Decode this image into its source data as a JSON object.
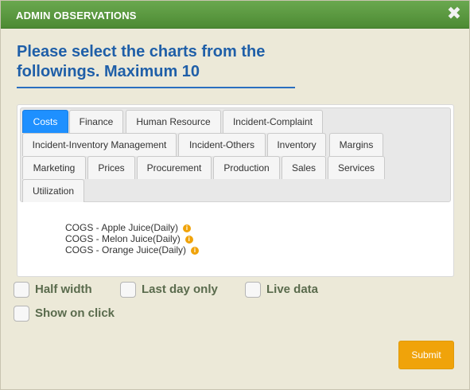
{
  "dialog": {
    "title": "ADMIN OBSERVATIONS",
    "close_icon": "close-icon",
    "heading": "Please select the charts from the followings. Maximum 10"
  },
  "tabs": [
    {
      "label": "Costs",
      "active": true
    },
    {
      "label": "Finance"
    },
    {
      "label": "Human Resource"
    },
    {
      "label": "Incident-Complaint"
    },
    {
      "label": "Incident-Inventory Management"
    },
    {
      "label": "Incident-Others"
    },
    {
      "label": "Inventory"
    },
    {
      "label": "Margins"
    },
    {
      "label": "Marketing"
    },
    {
      "label": "Prices"
    },
    {
      "label": "Procurement"
    },
    {
      "label": "Production"
    },
    {
      "label": "Sales"
    },
    {
      "label": "Services"
    },
    {
      "label": "Utilization"
    }
  ],
  "charts": [
    {
      "label": "COGS - Apple Juice(Daily)",
      "icon": "info-icon"
    },
    {
      "label": "COGS - Melon Juice(Daily)",
      "icon": "info-icon"
    },
    {
      "label": "COGS - Orange Juice(Daily)",
      "icon": "info-icon"
    }
  ],
  "options": [
    {
      "label": "Half width",
      "checked": false
    },
    {
      "label": "Last day only",
      "checked": false
    },
    {
      "label": "Live data",
      "checked": false
    },
    {
      "label": "Show on click",
      "checked": false
    }
  ],
  "submit_label": "Submit",
  "colors": {
    "titlebar": "#5a9a40",
    "heading": "#1f5fa8",
    "active_tab": "#1e90ff",
    "submit": "#f0a30a",
    "info_icon": "#f0a30a"
  }
}
